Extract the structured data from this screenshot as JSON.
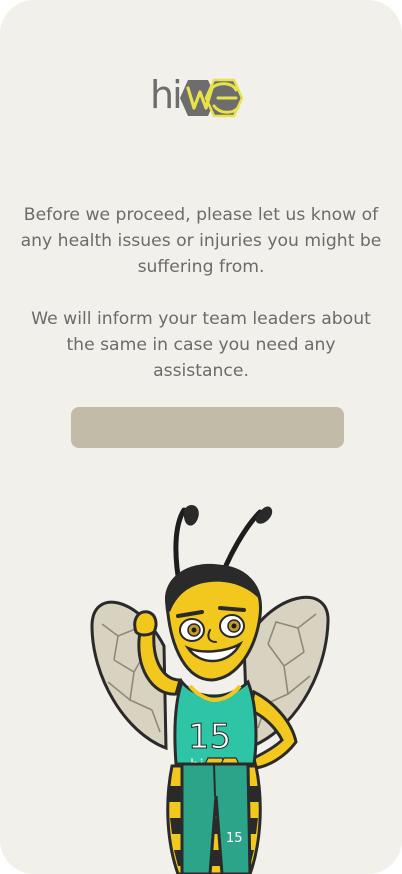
{
  "logo": {
    "text": "hi"
  },
  "message": {
    "paragraph_1": "Before we proceed, please let us know of any health issues or injuries you might be suffering from.",
    "paragraph_2": "We will inform your team leaders about the same in case you need any assistance."
  },
  "cta": {
    "label": ""
  },
  "mascot": {
    "jersey_number": "15",
    "jersey_brand": "hi",
    "shorts_number": "15"
  },
  "colors": {
    "background": "#f2f0eb",
    "text": "#6b6b6b",
    "button": "#c2bba8",
    "logo_yellow": "#e8e34a",
    "logo_gray": "#6d6d6d",
    "bee_yellow": "#f2c81e",
    "jersey_teal": "#2ec4a6"
  }
}
